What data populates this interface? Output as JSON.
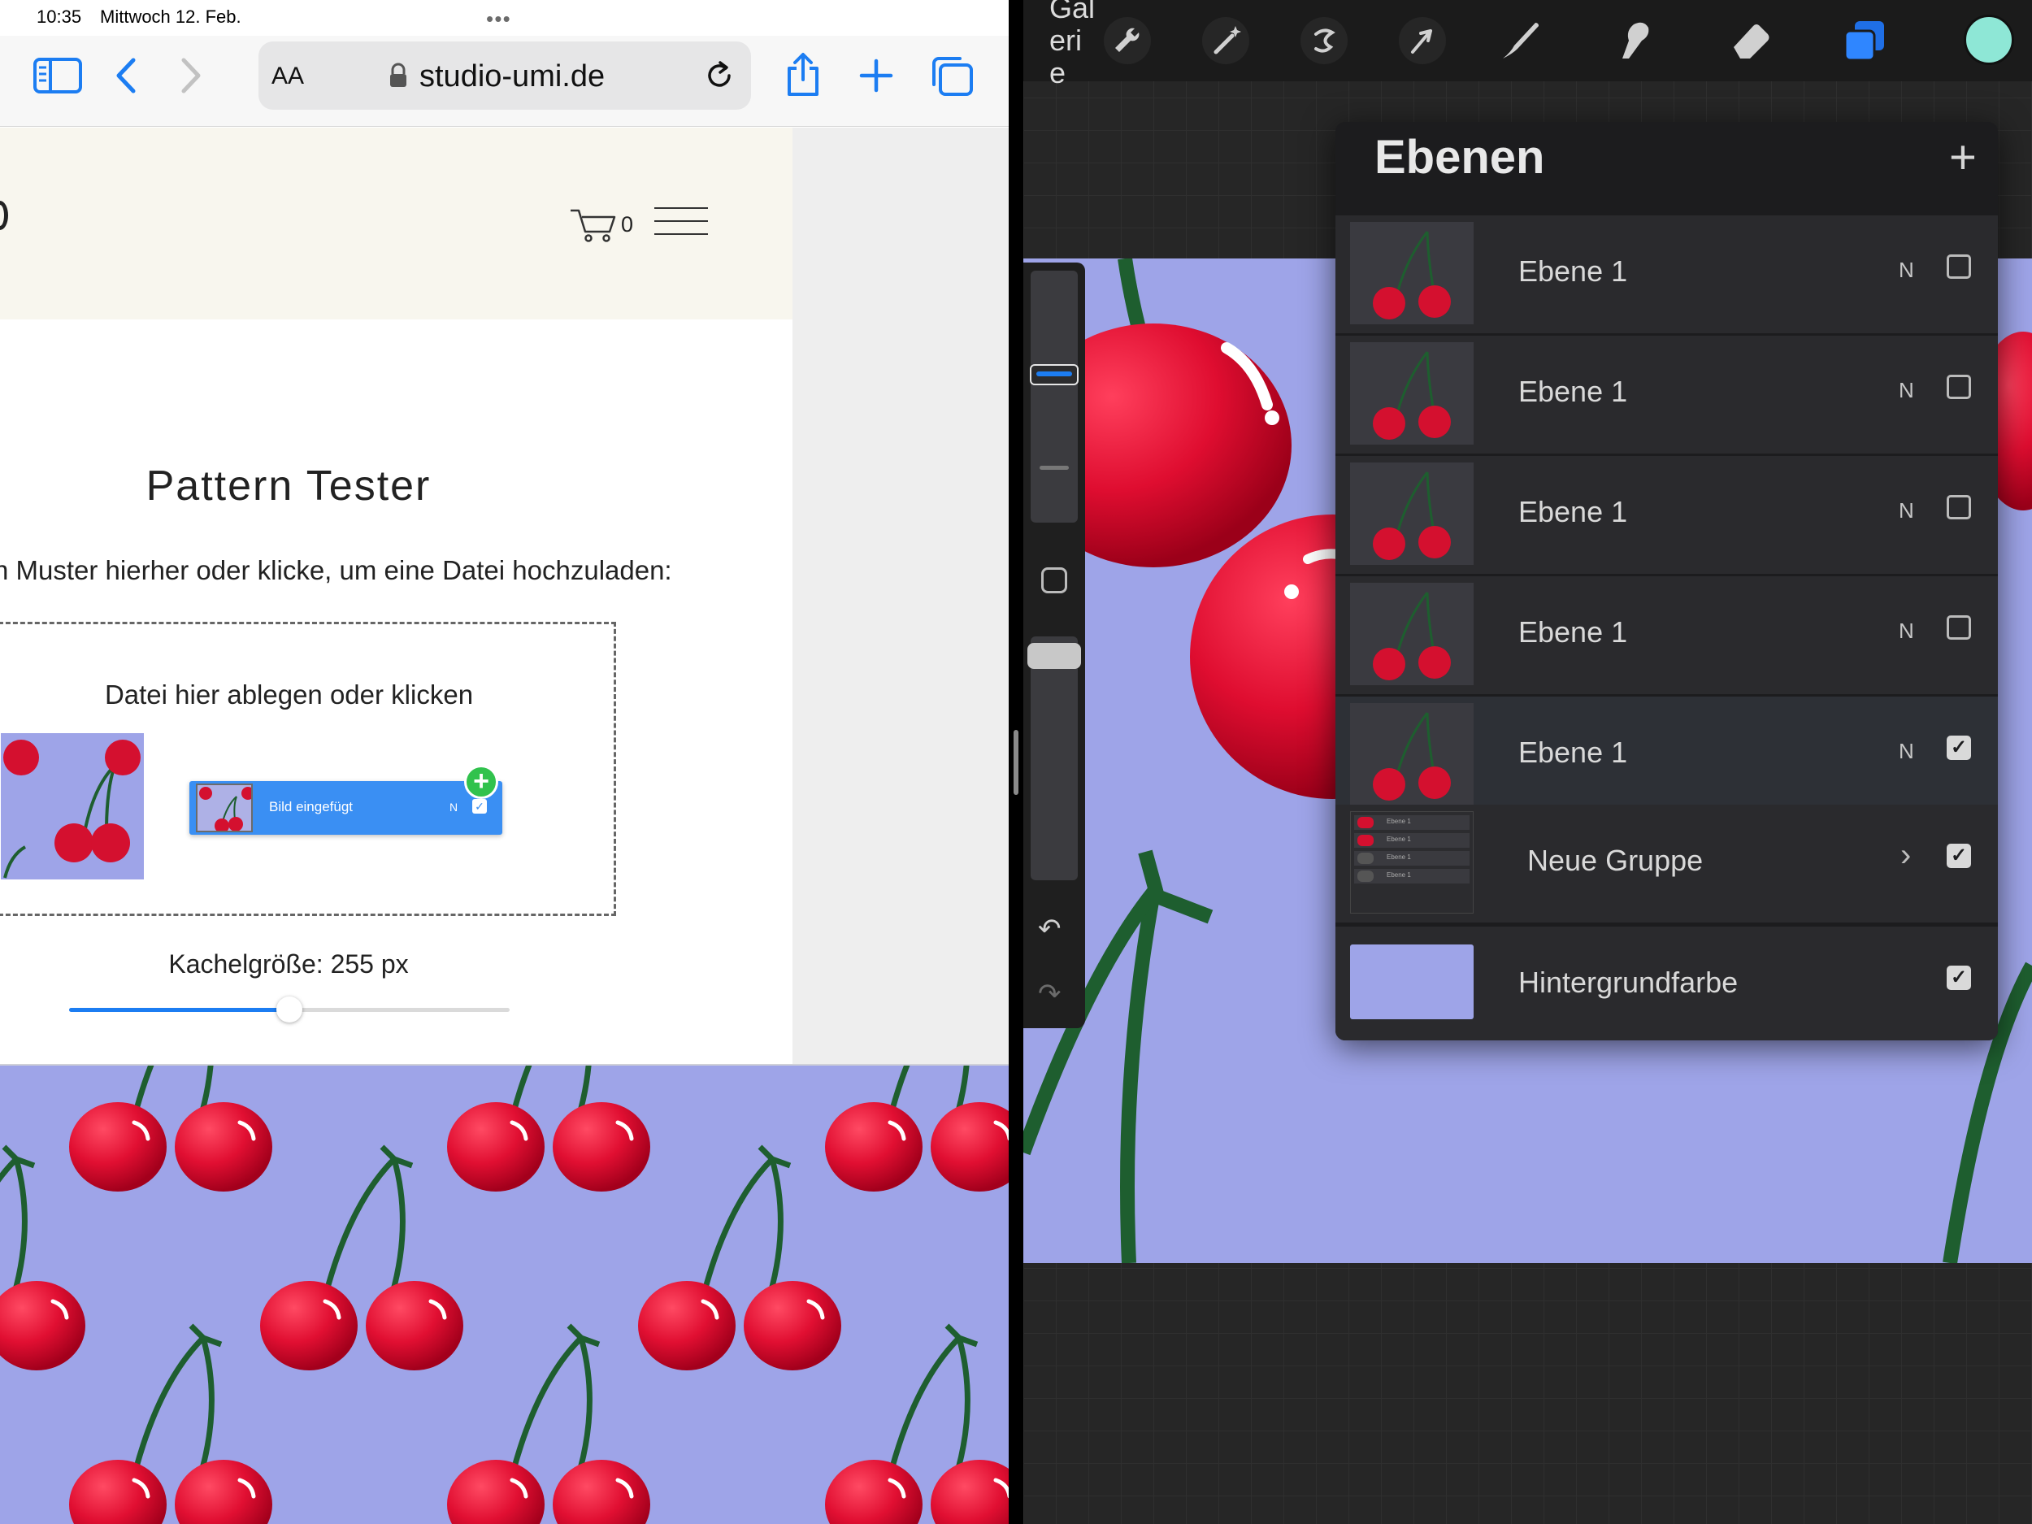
{
  "status_bar": {
    "time": "10:35",
    "date": "Mittwoch 12. Feb."
  },
  "safari": {
    "text_size_button": "AA",
    "url": "studio-umi.de",
    "accent_color": "#1c7df2"
  },
  "site": {
    "cart_count": "0",
    "title": "Pattern Tester",
    "instructions": "n Muster hierher oder klicke, um eine Datei hochzuladen:",
    "dropzone_label": "Datei hier ablegen oder klicken",
    "drag_chip": {
      "label": "Bild eingefügt",
      "mode": "N",
      "checked": true
    },
    "tile_size_label": "Kachelgröße: 255 px",
    "tile_size_slider_fraction": 0.5,
    "pattern_background": "#9ea4e8"
  },
  "procreate": {
    "gallery_label": "Gal eri e",
    "tools": [
      "wrench-icon",
      "magic-wand-icon",
      "selection-icon",
      "transform-arrow-icon",
      "brush-icon",
      "smudge-icon",
      "eraser-icon",
      "layers-icon"
    ],
    "active_color": "#8ee7d6",
    "layers_panel": {
      "title": "Ebenen",
      "add_button": "+",
      "layers": [
        {
          "name": "Ebene 1",
          "mode": "N",
          "visible": false
        },
        {
          "name": "Ebene 1",
          "mode": "N",
          "visible": false
        },
        {
          "name": "Ebene 1",
          "mode": "N",
          "visible": false
        },
        {
          "name": "Ebene 1",
          "mode": "N",
          "visible": false
        },
        {
          "name": "Ebene 1",
          "mode": "N",
          "visible": true
        }
      ],
      "group": {
        "name": "Neue Gruppe",
        "visible": true,
        "mini_labels": [
          "Ebene 1",
          "Ebene 1",
          "Ebene 1",
          "Ebene 1"
        ]
      },
      "background": {
        "name": "Hintergrundfarbe",
        "visible": true,
        "color": "#9ea4e8"
      }
    }
  }
}
